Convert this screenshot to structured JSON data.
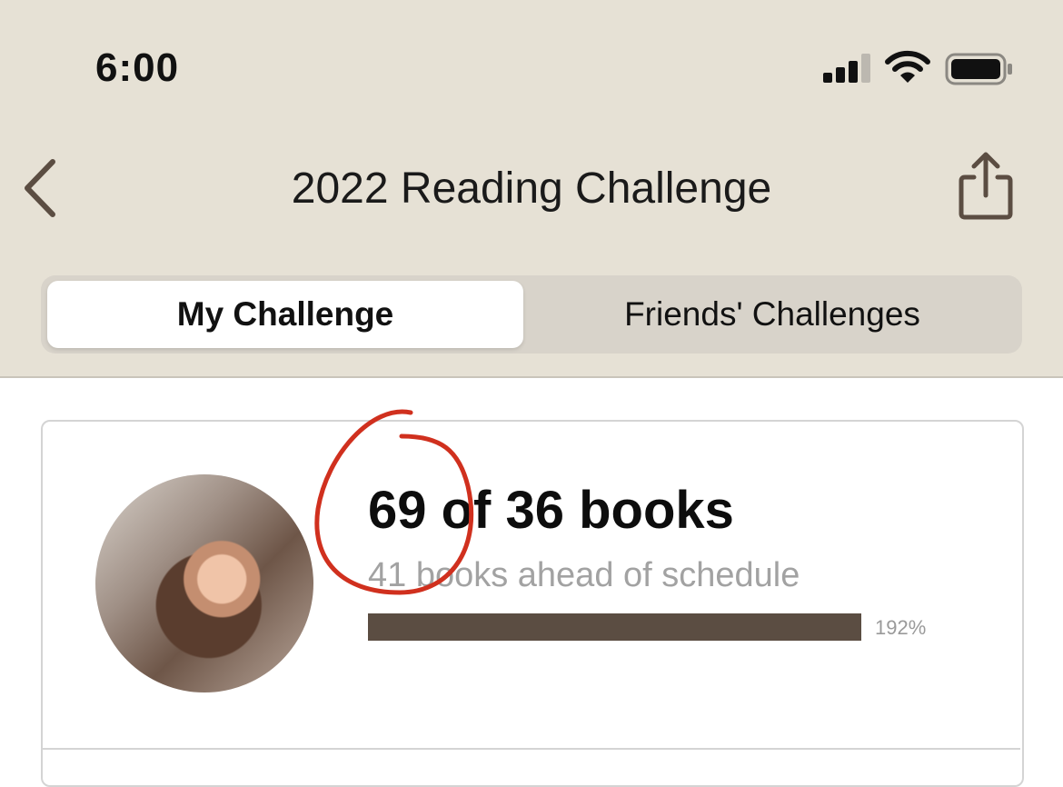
{
  "status_bar": {
    "time": "6:00",
    "icons": [
      "cellular-signal-icon",
      "wifi-icon",
      "battery-icon"
    ]
  },
  "nav": {
    "back_icon": "chevron-left-icon",
    "title": "2022 Reading Challenge",
    "share_icon": "share-icon"
  },
  "tabs": [
    {
      "label": "My Challenge",
      "selected": true
    },
    {
      "label": "Friends' Challenges",
      "selected": false
    }
  ],
  "challenge": {
    "count_text": "69 of 36 books",
    "status_text": "41 books ahead of schedule",
    "progress_percent": 192,
    "progress_label": "192%"
  },
  "annotation": {
    "type": "hand-drawn circle",
    "color": "#d0301e"
  },
  "colors": {
    "header_bg": "#e6e1d5",
    "progress_fill": "#5b4d42",
    "muted_text": "#a2a2a2"
  }
}
